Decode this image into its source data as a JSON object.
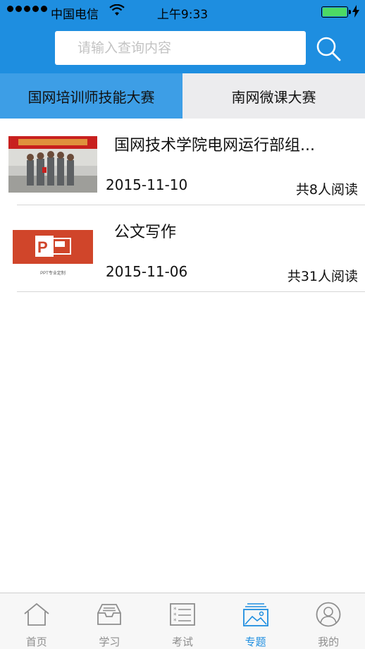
{
  "status_bar": {
    "carrier": "中国电信",
    "time": "上午9:33",
    "battery_color": "#4cd964"
  },
  "search": {
    "placeholder": "请输入查询内容",
    "icon": "search-icon"
  },
  "tabs": [
    {
      "label": "国网培训师技能大赛",
      "active": true
    },
    {
      "label": "南网微课大赛",
      "active": false
    }
  ],
  "articles": [
    {
      "title": "国网技术学院电网运行部组...",
      "date": "2015-11-10",
      "readers": "共8人阅读",
      "thumb_caption": ""
    },
    {
      "title": "公文写作",
      "date": "2015-11-06",
      "readers": "共31人阅读",
      "thumb_caption": "PPT专业定制"
    }
  ],
  "tab_bar": [
    {
      "label": "首页",
      "icon": "home-icon",
      "active": false
    },
    {
      "label": "学习",
      "icon": "inbox-icon",
      "active": false
    },
    {
      "label": "考试",
      "icon": "exam-list-icon",
      "active": false
    },
    {
      "label": "专题",
      "icon": "image-gallery-icon",
      "active": true
    },
    {
      "label": "我的",
      "icon": "user-icon",
      "active": false
    }
  ],
  "colors": {
    "brand_blue": "#1e8ee0",
    "tab_active": "#3d9ee6",
    "ppt_red": "#d0452a"
  }
}
